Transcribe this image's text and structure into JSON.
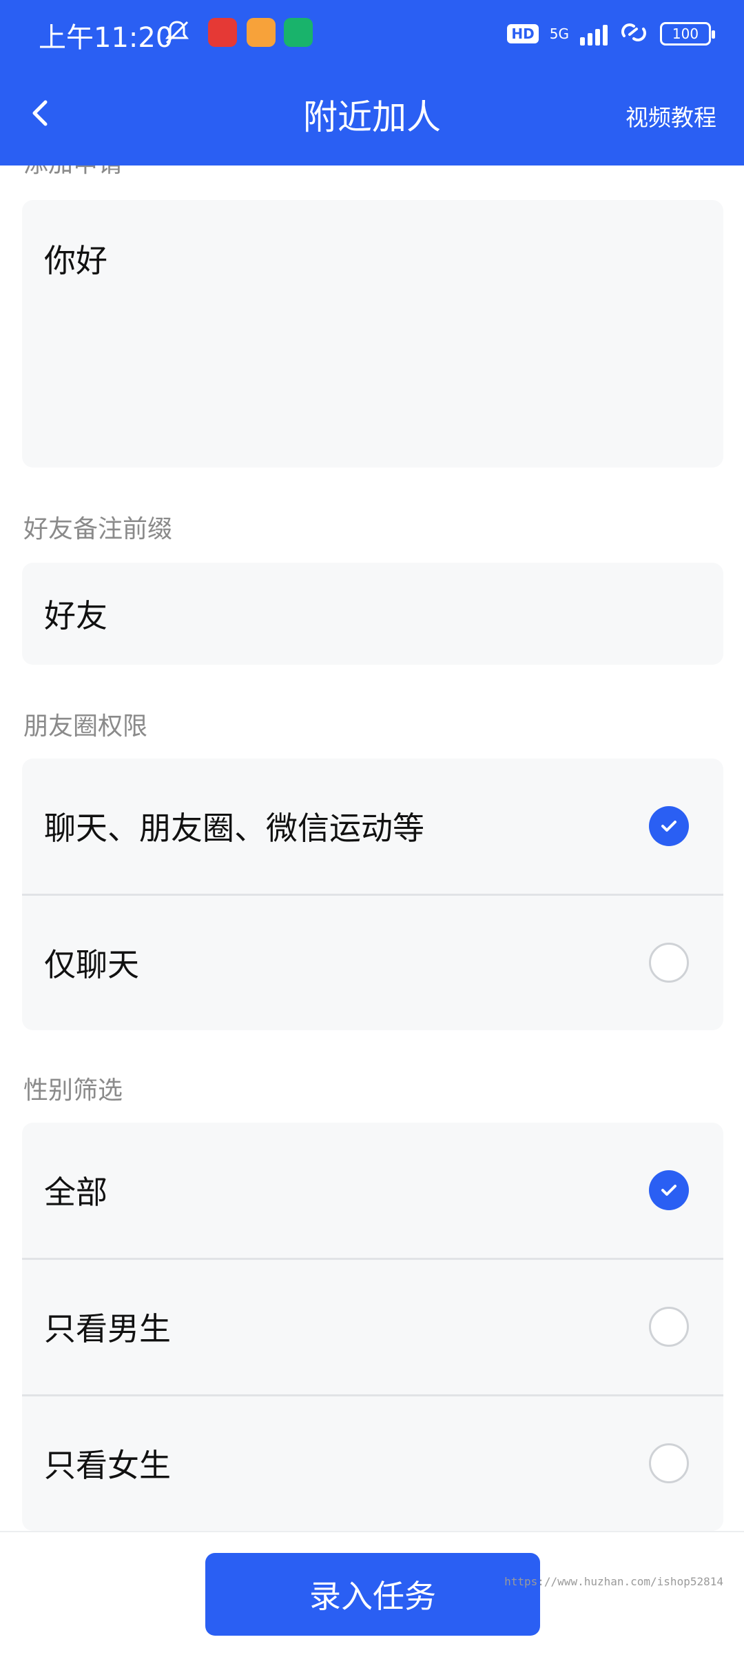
{
  "status_bar": {
    "time": "上午11:20",
    "network": "5G",
    "hd_badge": "HD",
    "battery": "100",
    "icons": [
      "bell-off-icon",
      "app-icon",
      "app-icon",
      "shield-icon",
      "signal-icon",
      "link-icon",
      "battery-icon"
    ]
  },
  "nav": {
    "title": "附近加人",
    "tutorial": "视频教程",
    "back_icon": "chevron-left-icon"
  },
  "form": {
    "request_label": "添加申请",
    "request_value": "你好",
    "remark_label": "好友备注前缀",
    "remark_value": "好友",
    "moments_label": "朋友圈权限",
    "moments_options": [
      {
        "label": "聊天、朋友圈、微信运动等",
        "checked": true
      },
      {
        "label": "仅聊天",
        "checked": false
      }
    ],
    "gender_label": "性别筛选",
    "gender_options": [
      {
        "label": "全部",
        "checked": true
      },
      {
        "label": "只看男生",
        "checked": false
      },
      {
        "label": "只看女生",
        "checked": false
      }
    ]
  },
  "footer": {
    "submit_label": "录入任务",
    "watermark": "https://www.huzhan.com/ishop52814"
  },
  "colors": {
    "primary": "#2a5ff3",
    "card_bg": "#f7f8f9",
    "label_gray": "#8a8a8a"
  }
}
